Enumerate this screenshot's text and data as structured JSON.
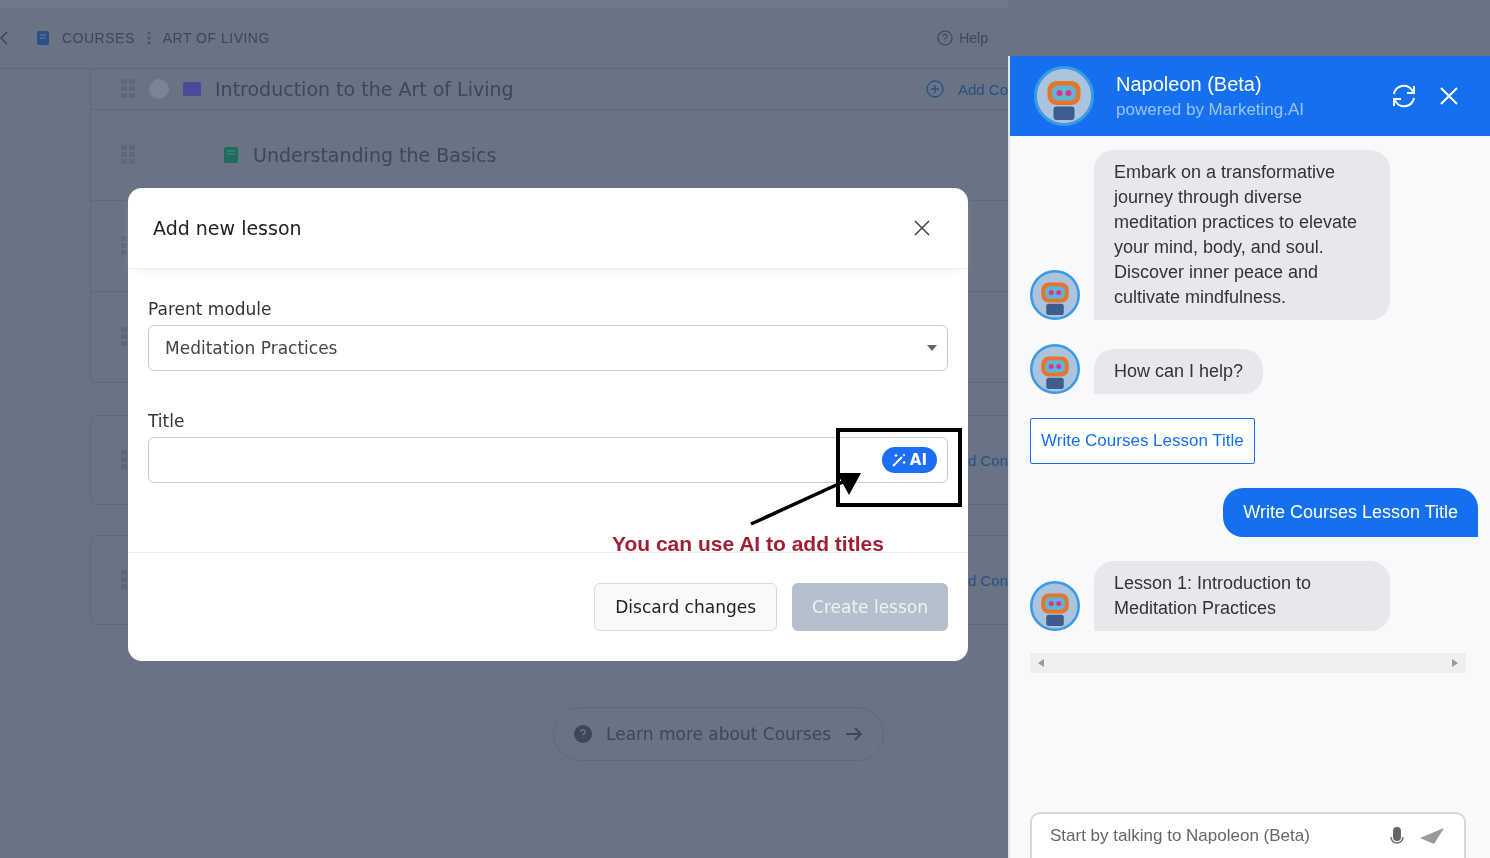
{
  "breadcrumb": [
    "COURSES",
    "ART OF LIVING"
  ],
  "help": "Help",
  "outline": [
    {
      "kind": "module",
      "title": "Introduction to the Art of Living",
      "action": "Add Co"
    },
    {
      "kind": "lesson",
      "title": "Understanding the Basics"
    },
    {
      "kind": "empty"
    },
    {
      "kind": "empty"
    }
  ],
  "cards": [
    {
      "action": "d Con"
    },
    {
      "action": "d Con"
    }
  ],
  "learn_more": "Learn more about Courses",
  "modal": {
    "title": "Add new lesson",
    "parent_label": "Parent module",
    "parent_value": "Meditation Practices",
    "title_label": "Title",
    "ai_button": "AI",
    "discard": "Discard changes",
    "create": "Create lesson",
    "create_disabled": true
  },
  "annotation": "You can use AI to add titles",
  "chat": {
    "name": "Napoleon (Beta)",
    "subtitle": "powered by Marketing.AI",
    "messages": [
      {
        "kind": "bot",
        "text": "Embark on a transformative journey through diverse meditation practices to elevate your mind, body, and soul. Discover inner peace and cultivate mindfulness."
      },
      {
        "kind": "bot",
        "text": "How can I help?"
      },
      {
        "kind": "suggestion",
        "text": "Write Courses Lesson Title"
      },
      {
        "kind": "user",
        "text": "Write Courses Lesson Title"
      },
      {
        "kind": "bot",
        "text": "Lesson 1: Introduction to Meditation Practices"
      }
    ],
    "placeholder": "Start by talking to Napoleon (Beta)"
  }
}
